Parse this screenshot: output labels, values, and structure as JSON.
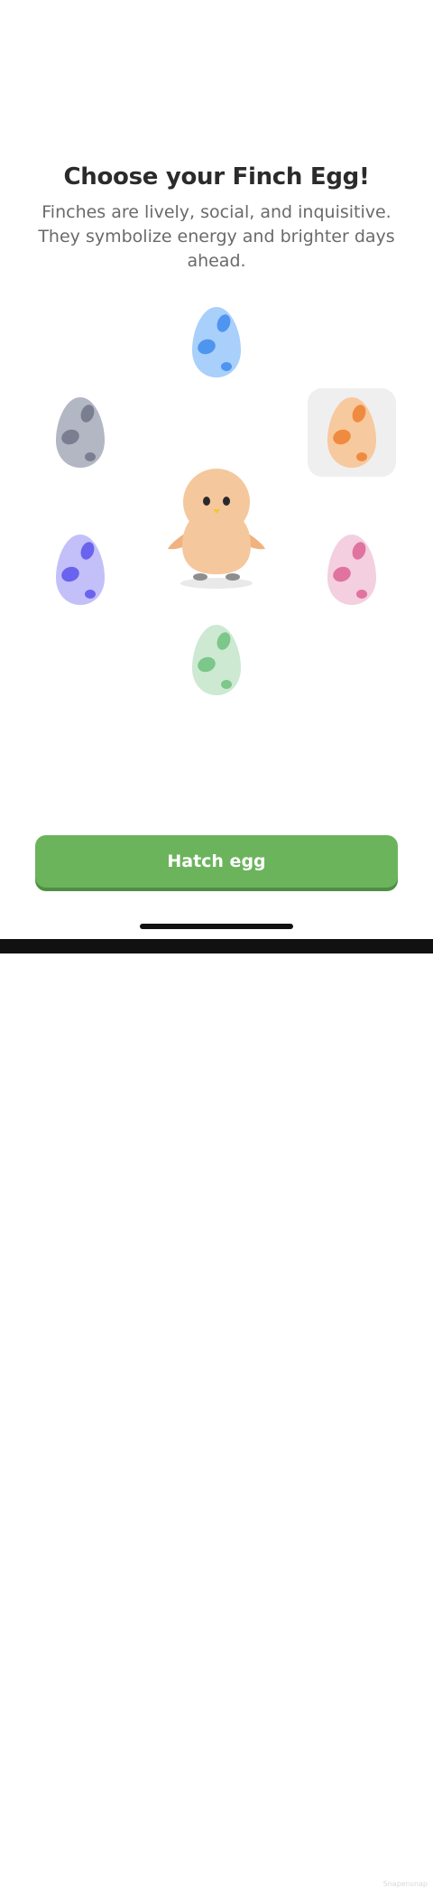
{
  "header": {
    "title": "Choose your Finch Egg!",
    "subtitle": "Finches are lively, social, and inquisitive. They symbolize energy and brighter days ahead."
  },
  "eggs": [
    {
      "color": "blue",
      "shell": "#a9cffb",
      "spot": "#4e95f0",
      "selected": false
    },
    {
      "color": "gray",
      "shell": "#b3b6c3",
      "spot": "#7a7e90",
      "selected": false
    },
    {
      "color": "orange",
      "shell": "#f7c99e",
      "spot": "#ef8b40",
      "selected": true
    },
    {
      "color": "purple",
      "shell": "#c3c0f9",
      "spot": "#6a63ee",
      "selected": false
    },
    {
      "color": "pink",
      "shell": "#f4cfe0",
      "spot": "#e0739f",
      "selected": false
    },
    {
      "color": "green",
      "shell": "#cde9d2",
      "spot": "#7cc789",
      "selected": false
    }
  ],
  "finch": {
    "body": "#f5c79c",
    "wing": "#f0b27e",
    "beak": "#f2c832",
    "feet": "#8e8e8e"
  },
  "cta": {
    "label": "Hatch egg",
    "color": "#6bb45c"
  },
  "footer": {
    "watermark": "Snapensnap"
  }
}
